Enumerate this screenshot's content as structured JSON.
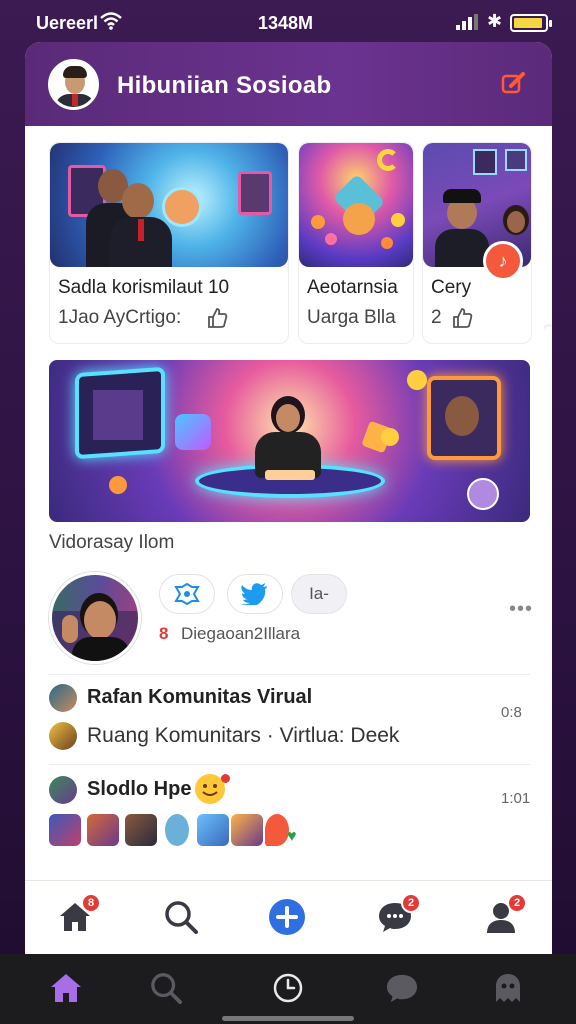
{
  "status_bar": {
    "carrier": "Uereerl",
    "time": "1348M"
  },
  "header": {
    "title": "Hibuniian  Sosioab"
  },
  "stories": [
    {
      "line1": "Sadla korismilaut 10",
      "line2": "1Jao AyCrtigo:"
    },
    {
      "line1": "Aeotarnsia",
      "line2": "Uarga Blla"
    },
    {
      "line1": "Cery",
      "line2": "2"
    }
  ],
  "banner": {
    "caption": "Vidorasay Ilom"
  },
  "post": {
    "share_label": "Ia-",
    "meta": "Diegaoan2Illara"
  },
  "list": {
    "row1_title": "Rafan Komunitas Virual",
    "row1_time": "0:8",
    "row2_subtitle": "Ruang Komunitars · Virtlua: Deek",
    "row3_title": "Slodlo Hpe",
    "row3_time": "1:01"
  },
  "bottom_nav": {
    "badges": {
      "home": "8",
      "messages": "2",
      "profile": "2"
    }
  },
  "colors": {
    "header": "#6b3390",
    "accent": "#2f6fe0",
    "badge": "#e53935",
    "system_bar": "#1c1c1e"
  },
  "icons": [
    "wifi-icon",
    "bluetooth-icon",
    "battery-icon",
    "compose-icon",
    "like-icon",
    "twitter-icon",
    "home-icon",
    "search-icon",
    "plus-icon",
    "chat-icon",
    "profile-icon",
    "clock-icon"
  ]
}
